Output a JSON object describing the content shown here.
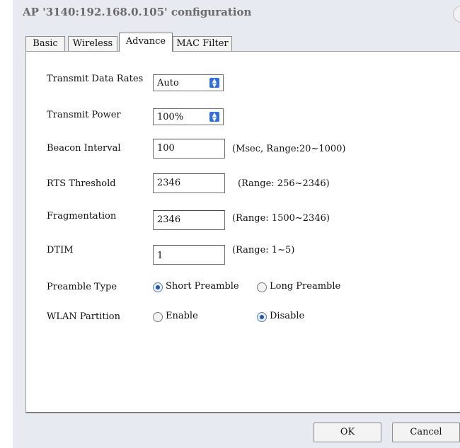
{
  "window": {
    "title": "AP '3140:192.168.0.105' configuration"
  },
  "tabs": [
    {
      "label": "Basic"
    },
    {
      "label": "Wireless"
    },
    {
      "label": "Advance"
    },
    {
      "label": "MAC Filter"
    }
  ],
  "form": {
    "transmit_data_rates": {
      "label": "Transmit Data Rates",
      "value": "Auto"
    },
    "transmit_power": {
      "label": "Transmit Power",
      "value": "100%"
    },
    "beacon_interval": {
      "label": "Beacon Interval",
      "value": "100",
      "hint": "(Msec, Range:20~1000)"
    },
    "rts_threshold": {
      "label": "RTS Threshold",
      "value": "2346",
      "hint": "(Range: 256~2346)"
    },
    "fragmentation": {
      "label": "Fragmentation",
      "value": "2346",
      "hint": "(Range: 1500~2346)"
    },
    "dtim": {
      "label": "DTIM",
      "value": "1",
      "hint": "(Range: 1~5)"
    },
    "preamble_type": {
      "label": "Preamble Type",
      "options": [
        "Short Preamble",
        "Long Preamble"
      ],
      "selected": "Short Preamble"
    },
    "wlan_partition": {
      "label": "WLAN Partition",
      "options": [
        "Enable",
        "Disable"
      ],
      "selected": "Disable"
    }
  },
  "buttons": {
    "ok": "OK",
    "cancel": "Cancel"
  },
  "colors": {
    "window_bg": "#e7eaf1",
    "radio_accent": "#1f54b8",
    "spin_accent": "#2f6fe0"
  }
}
